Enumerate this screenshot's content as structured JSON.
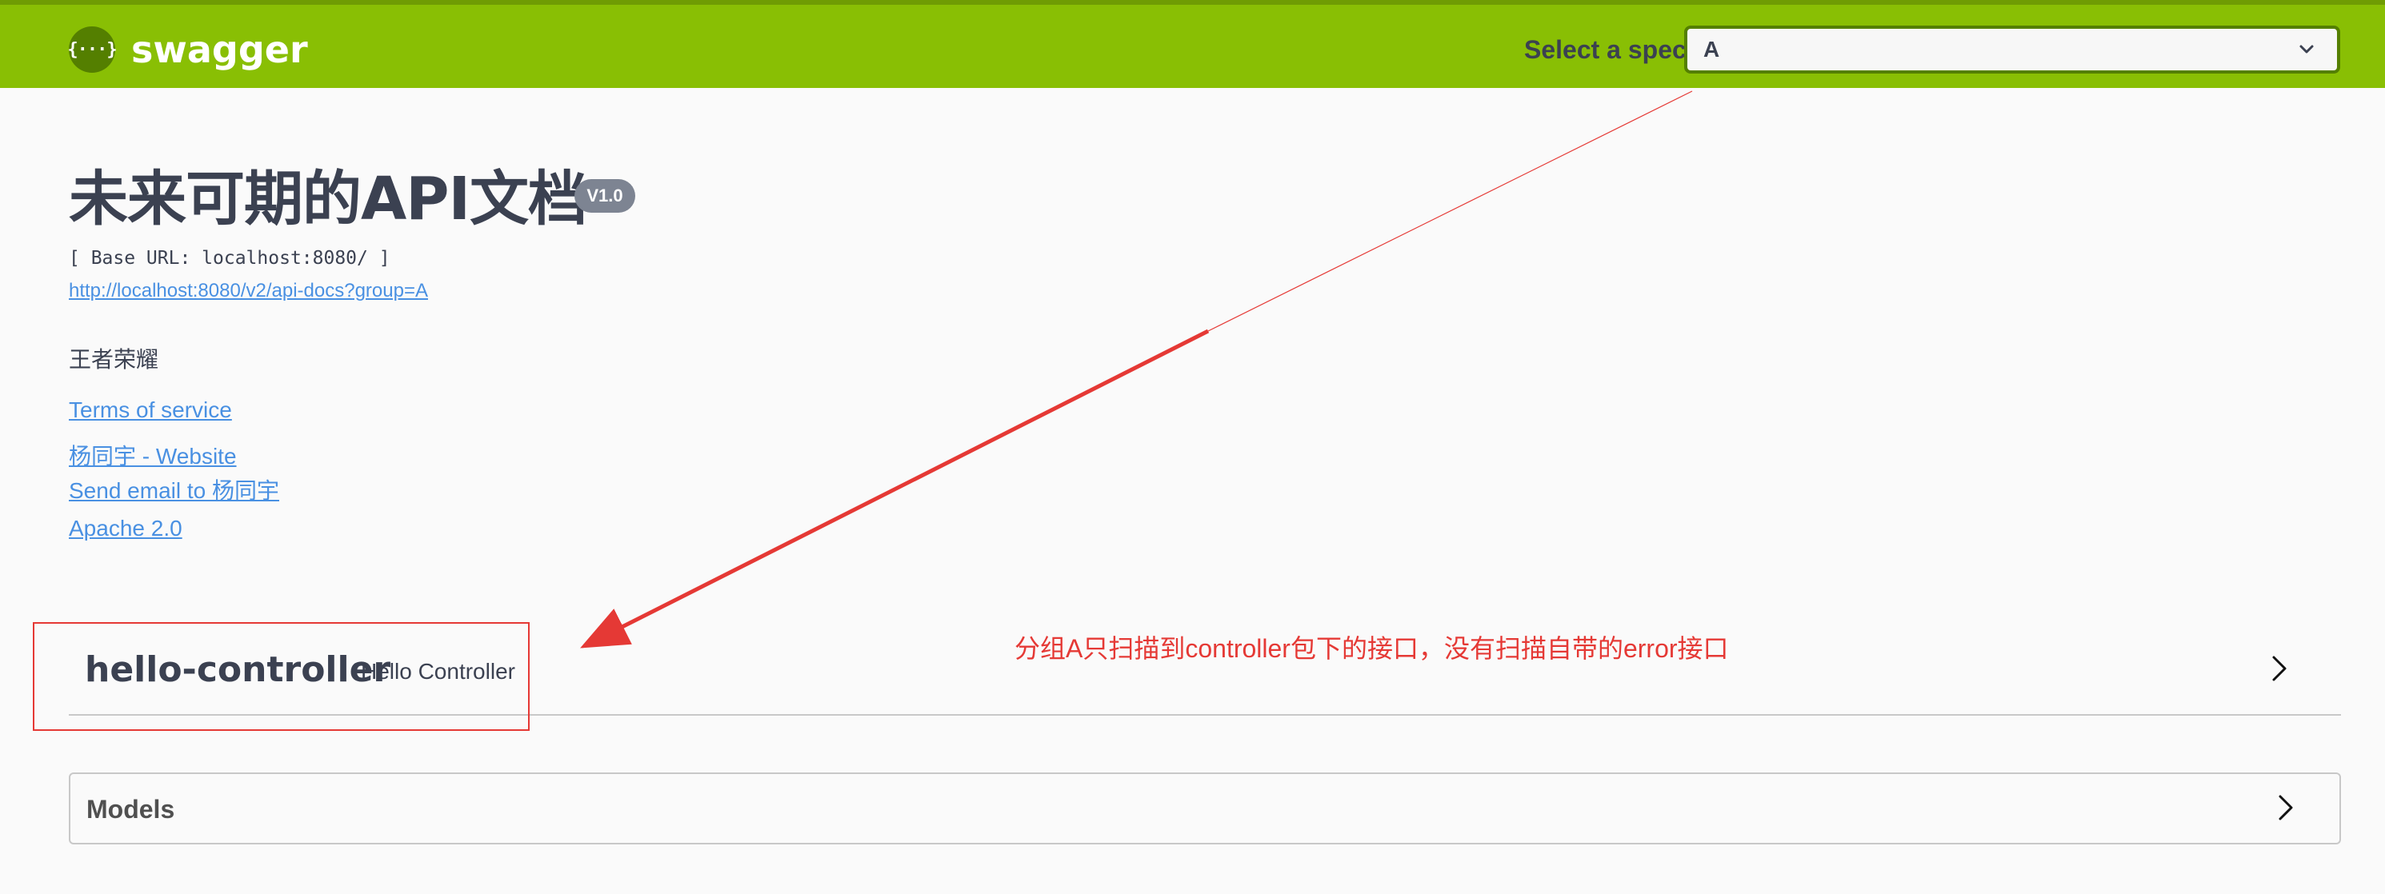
{
  "topbar": {
    "logo_glyph": "{···}",
    "logo_text": "swagger",
    "spec_label": "Select a spec",
    "spec_selected": "A",
    "brand_color": "#89bf04"
  },
  "info": {
    "title": "未来可期的API文档",
    "version": "V1.0",
    "base_url": "[ Base URL: localhost:8080/ ]",
    "api_docs_url": "http://localhost:8080/v2/api-docs?group=A",
    "description": "王者荣耀",
    "links": {
      "terms": "Terms of service",
      "website": "杨同宇 - Website",
      "email": "Send email to 杨同宇",
      "license": "Apache 2.0"
    }
  },
  "annotation": {
    "text": "分组A只扫描到controller包下的接口，没有扫描自带的error接口",
    "color": "#e53935"
  },
  "tags": [
    {
      "name": "hello-controller",
      "description": "Hello Controller"
    }
  ],
  "models": {
    "title": "Models"
  },
  "icons": {
    "spec_dropdown": "chevron-down-icon",
    "tag_expand": "chevron-right-icon",
    "models_expand": "chevron-right-icon",
    "logo": "swagger-logo-icon"
  }
}
